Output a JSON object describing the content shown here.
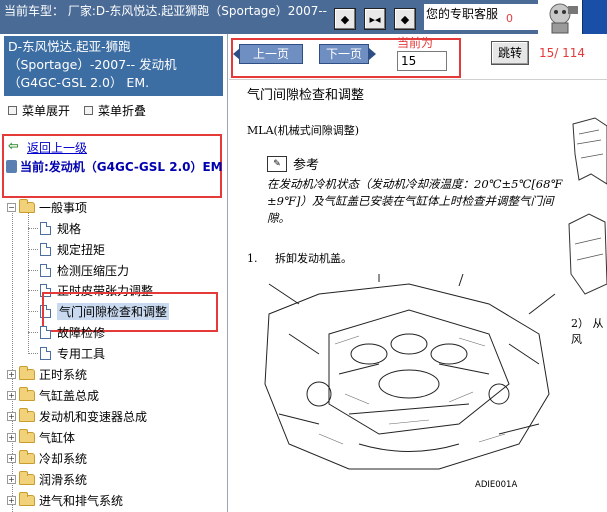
{
  "topbar": {
    "vehicle_text": "当前车型： 厂家:D-东风悦达.起亚狮跑（Sportage）2007--",
    "nav_first": "◆",
    "nav_mid": "▸◂",
    "nav_last": "◆",
    "support_label": "您的专职客服",
    "support_mark": "0"
  },
  "sidebar": {
    "car_title": "D-东风悦达.起亚-狮跑（Sportage）-2007-- 发动机（G4GC-GSL 2.0） EM.",
    "menu_expand": "菜单展开",
    "menu_collapse": "菜单折叠",
    "back_label": "返回上一级",
    "current_label": "当前:发动机（G4GC-GSL 2.0）EM",
    "tree": [
      {
        "label": "一般事项",
        "type": "folder",
        "expanded": true
      },
      {
        "label": "规格",
        "type": "doc"
      },
      {
        "label": "规定扭矩",
        "type": "doc"
      },
      {
        "label": "检测压缩压力",
        "type": "doc"
      },
      {
        "label": "正时皮带张力调整",
        "type": "doc"
      },
      {
        "label": "气门间隙检查和调整",
        "type": "doc",
        "selected": true
      },
      {
        "label": "故障检修",
        "type": "doc"
      },
      {
        "label": "专用工具",
        "type": "doc"
      },
      {
        "label": "正时系统",
        "type": "folder",
        "expanded": false
      },
      {
        "label": "气缸盖总成",
        "type": "folder",
        "expanded": false
      },
      {
        "label": "发动机和变速器总成",
        "type": "folder",
        "expanded": false
      },
      {
        "label": "气缸体",
        "type": "folder",
        "expanded": false
      },
      {
        "label": "冷却系统",
        "type": "folder",
        "expanded": false
      },
      {
        "label": "润滑系统",
        "type": "folder",
        "expanded": false
      },
      {
        "label": "进气和排气系统",
        "type": "folder",
        "expanded": false
      }
    ]
  },
  "pager": {
    "prev_label": "上一页",
    "next_label": "下一页",
    "current_label": "当前为",
    "page_value": "15",
    "jump_label": "跳转",
    "page_count": "15/ 114"
  },
  "document": {
    "title": "气门间隙检查和调整",
    "subtitle": "MLA(机械式间隙调整)",
    "ref_icon": "✎",
    "ref_title": "参考",
    "ref_text": "在发动机冷机状态（发动机冷却液温度：20℃±5℃[68℉±9℉]）及气缸盖已安装在气缸体上时检查并调整气门间隙。",
    "step1_num": "1.",
    "step1_text": "拆卸发动机盖。",
    "step2_text": "2） 从风",
    "figure_label": "ADIE001A"
  },
  "colors": {
    "topbar": "#4a6b96",
    "car_box": "#3c6da3",
    "highlight_box": "#e53a3a",
    "link": "#0000cc"
  }
}
